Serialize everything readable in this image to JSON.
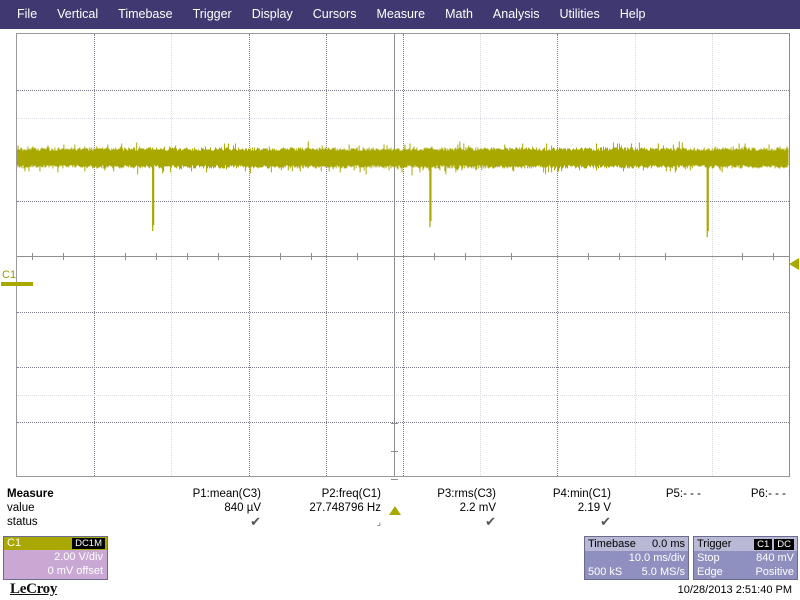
{
  "menu": {
    "items": [
      {
        "label": "File"
      },
      {
        "label": "Vertical"
      },
      {
        "label": "Timebase"
      },
      {
        "label": "Trigger"
      },
      {
        "label": "Display"
      },
      {
        "label": "Cursors"
      },
      {
        "label": "Measure"
      },
      {
        "label": "Math"
      },
      {
        "label": "Analysis"
      },
      {
        "label": "Utilities"
      },
      {
        "label": "Help"
      }
    ]
  },
  "grid": {
    "channel_marker_label": "C1",
    "divisions_horizontal": 10,
    "divisions_vertical": 8,
    "trace_color": "#a8a800"
  },
  "measure": {
    "row_labels": {
      "header": "Measure",
      "value": "value",
      "status": "status"
    },
    "columns": [
      {
        "name": "P1:mean(C3)",
        "value": "840 µV",
        "status": "check"
      },
      {
        "name": "P2:freq(C1)",
        "value": "27.748796 Hz",
        "status": "pulse"
      },
      {
        "name": "P3:rms(C3)",
        "value": "2.2 mV",
        "status": "check"
      },
      {
        "name": "P4:min(C1)",
        "value": "2.19 V",
        "status": "check"
      },
      {
        "name": "P5:- - -",
        "value": "",
        "status": ""
      },
      {
        "name": "P6:- - -",
        "value": "",
        "status": ""
      }
    ]
  },
  "channel": {
    "name": "C1",
    "coupling": "DC1M",
    "volts_per_div": "2.00 V/div",
    "offset": "0 mV offset"
  },
  "timebase": {
    "title": "Timebase",
    "delay": "0.0 ms",
    "time_per_div": "10.0 ms/div",
    "memory": "500 kS",
    "sample_rate": "5.0 MS/s"
  },
  "trigger": {
    "title": "Trigger",
    "source": "C1",
    "coupling": "DC",
    "state": "Stop",
    "level": "840 mV",
    "type": "Edge",
    "slope": "Positive"
  },
  "footer": {
    "logo": "LeCroy",
    "timestamp": "10/28/2013 2:51:40 PM"
  }
}
